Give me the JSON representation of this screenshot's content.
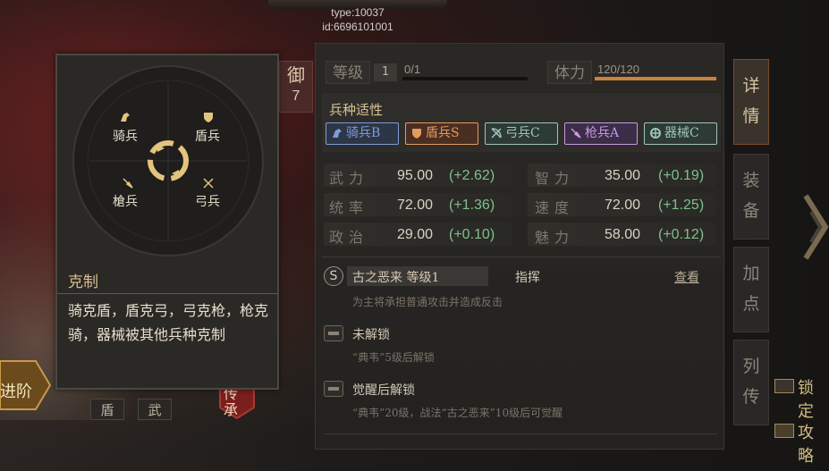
{
  "debug": {
    "type": "type:10037",
    "id": "id:6696101001"
  },
  "defense_tab": {
    "char": "御",
    "num": "7"
  },
  "header": {
    "level_label": "等级",
    "level_value": "1",
    "exp": "0/1",
    "exp_fraction": 0.0,
    "stamina_label": "体力",
    "stamina": "120/120",
    "stamina_fraction": 1.0
  },
  "troops": {
    "title": "兵种适性",
    "tags": [
      {
        "label": "骑兵B",
        "color": "#7e9cd8",
        "bg": "#2d3646",
        "icon": "horse-icon"
      },
      {
        "label": "盾兵S",
        "color": "#e59a5e",
        "bg": "#4a2e22",
        "icon": "shield-icon"
      },
      {
        "label": "弓兵C",
        "color": "#9fc6b8",
        "bg": "#2d3a36",
        "icon": "bow-icon"
      },
      {
        "label": "枪兵A",
        "color": "#c69ae2",
        "bg": "#3c2d48",
        "icon": "spear-icon"
      },
      {
        "label": "器械C",
        "color": "#9fc6b8",
        "bg": "#2d3a36",
        "icon": "gear-icon"
      }
    ]
  },
  "stats": {
    "left": [
      {
        "label": "武力",
        "value": "95.00",
        "bonus": "(+2.62)"
      },
      {
        "label": "统率",
        "value": "72.00",
        "bonus": "(+1.36)"
      },
      {
        "label": "政治",
        "value": "29.00",
        "bonus": "(+0.10)"
      }
    ],
    "right": [
      {
        "label": "智力",
        "value": "35.00",
        "bonus": "(+0.19)"
      },
      {
        "label": "速度",
        "value": "72.00",
        "bonus": "(+1.25)"
      },
      {
        "label": "魅力",
        "value": "58.00",
        "bonus": "(+0.12)"
      }
    ]
  },
  "skills": [
    {
      "badge": "S",
      "name": "古之恶来 等级1",
      "type": "指挥",
      "action": "查看",
      "desc": "为主将承担普通攻击并造成反击"
    },
    {
      "name": "未解锁",
      "desc": "“典韦”5级后解锁"
    },
    {
      "name": "觉醒后解锁",
      "desc": "“典韦”20级，战法“古之恶来”10级后可觉醒"
    }
  ],
  "side_tabs": [
    "详情",
    "装备",
    "加点",
    "列传"
  ],
  "far_right": {
    "lock": "锁定",
    "attack": "攻略"
  },
  "tooltip": {
    "wheel": {
      "cavalry": "骑兵",
      "shield": "盾兵",
      "spear": "槍兵",
      "bow": "弓兵"
    },
    "title": "克制",
    "body": "骑克盾，盾克弓，弓克枪，枪克骑，器械被其他兵种克制"
  },
  "bottom_left": {
    "advance": "进阶",
    "tab1": "盾",
    "tab2": "武",
    "seal": "传承"
  }
}
